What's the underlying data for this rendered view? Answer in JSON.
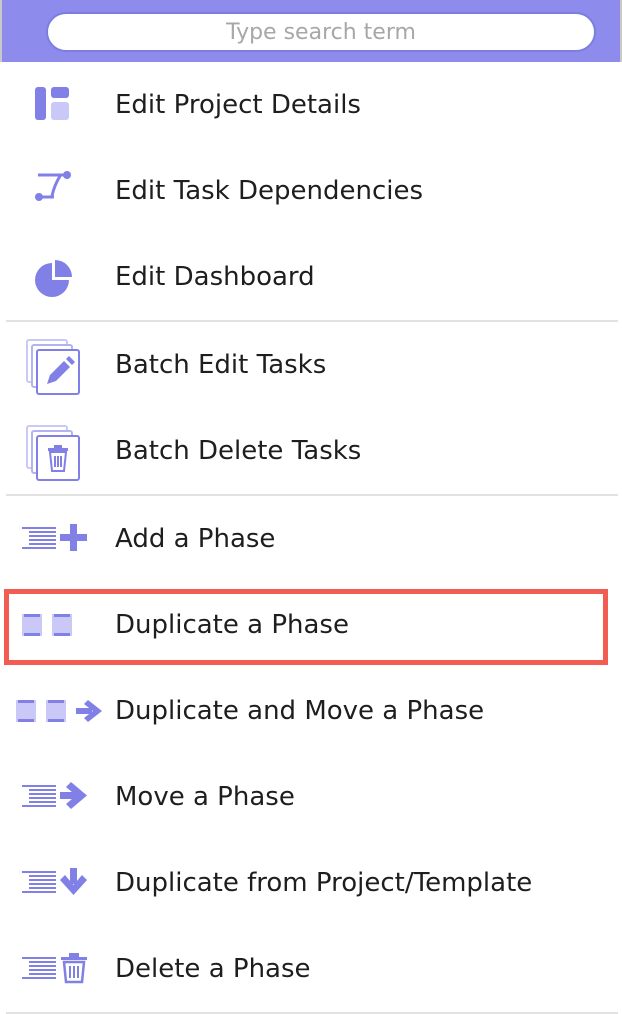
{
  "search": {
    "placeholder": "Type search term"
  },
  "menu": {
    "items": [
      {
        "label": "Edit Project Details",
        "icon": "project-details-icon"
      },
      {
        "label": "Edit Task Dependencies",
        "icon": "task-dependencies-icon"
      },
      {
        "label": "Edit Dashboard",
        "icon": "pie-chart-icon"
      },
      {
        "label": "Batch Edit Tasks",
        "icon": "batch-edit-icon"
      },
      {
        "label": "Batch Delete Tasks",
        "icon": "batch-delete-icon"
      },
      {
        "label": "Add a Phase",
        "icon": "phase-add-icon"
      },
      {
        "label": "Duplicate a Phase",
        "icon": "phase-duplicate-icon"
      },
      {
        "label": "Duplicate and Move a Phase",
        "icon": "phase-duplicate-move-icon"
      },
      {
        "label": "Move a Phase",
        "icon": "phase-move-icon"
      },
      {
        "label": "Duplicate from Project/Template",
        "icon": "phase-import-icon"
      },
      {
        "label": "Delete a Phase",
        "icon": "phase-delete-icon"
      }
    ]
  },
  "colors": {
    "accent": "#8d8cec",
    "icon": "#8180e6",
    "highlight": "#f25c53"
  }
}
